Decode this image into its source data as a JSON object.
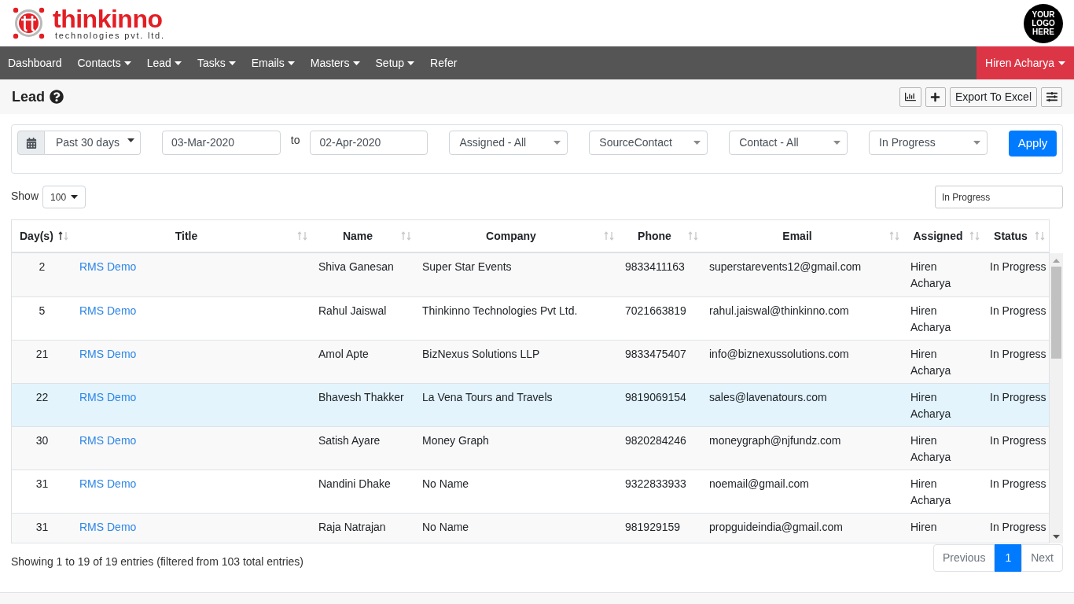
{
  "header": {
    "logo": {
      "name": "thinkinno",
      "tagline": "technologies pvt. ltd."
    },
    "client_logo": "YOUR LOGO HERE"
  },
  "nav": {
    "items": [
      {
        "label": "Dashboard",
        "dropdown": false
      },
      {
        "label": "Contacts",
        "dropdown": true
      },
      {
        "label": "Lead",
        "dropdown": true
      },
      {
        "label": "Tasks",
        "dropdown": true
      },
      {
        "label": "Emails",
        "dropdown": true
      },
      {
        "label": "Masters",
        "dropdown": true
      },
      {
        "label": "Setup",
        "dropdown": true
      },
      {
        "label": "Refer",
        "dropdown": false
      }
    ],
    "user": {
      "label": "Hiren Acharya",
      "dropdown": true
    }
  },
  "page": {
    "title": "Lead",
    "toolbar": [
      {
        "kind": "chart"
      },
      {
        "kind": "add"
      },
      {
        "kind": "text",
        "label": "Export To Excel"
      },
      {
        "kind": "sliders"
      }
    ]
  },
  "filters": {
    "range": "Past 30 days",
    "from": "03-Mar-2020",
    "to_label": "to",
    "to": "02-Apr-2020",
    "selects": [
      "Assigned - All",
      "SourceContact",
      "Contact - All",
      "In Progress"
    ],
    "apply": "Apply"
  },
  "table_controls": {
    "show_label": "Show",
    "page_length": "100",
    "search": "In Progress"
  },
  "table": {
    "columns": [
      {
        "label": "Day(s)",
        "sorted_ascending": true
      },
      {
        "label": "Title",
        "sorted_ascending": false
      },
      {
        "label": "Name",
        "sorted_ascending": false
      },
      {
        "label": "Company",
        "sorted_ascending": false
      },
      {
        "label": "Phone",
        "sorted_ascending": false
      },
      {
        "label": "Email",
        "sorted_ascending": false
      },
      {
        "label": "Assigned",
        "sorted_ascending": false
      },
      {
        "label": "Status",
        "sorted_ascending": false
      }
    ],
    "rows": [
      {
        "days": "2",
        "title": "RMS Demo",
        "name": "Shiva Ganesan",
        "company": "Super Star Events",
        "phone": "9833411163",
        "email": "superstarevents12@gmail.com",
        "assigned": "Hiren Acharya",
        "status": "In Progress",
        "selected": false
      },
      {
        "days": "5",
        "title": "RMS Demo",
        "name": "Rahul Jaiswal",
        "company": "Thinkinno Technologies Pvt Ltd.",
        "phone": "7021663819",
        "email": "rahul.jaiswal@thinkinno.com",
        "assigned": "Hiren Acharya",
        "status": "In Progress",
        "selected": false
      },
      {
        "days": "21",
        "title": "RMS Demo",
        "name": "Amol Apte",
        "company": "BizNexus Solutions LLP",
        "phone": "9833475407",
        "email": "info@biznexussolutions.com",
        "assigned": "Hiren Acharya",
        "status": "In Progress",
        "selected": false
      },
      {
        "days": "22",
        "title": "RMS Demo",
        "name": "Bhavesh Thakker",
        "company": "La Vena Tours and Travels",
        "phone": "9819069154",
        "email": "sales@lavenatours.com",
        "assigned": "Hiren Acharya",
        "status": "In Progress",
        "selected": true
      },
      {
        "days": "30",
        "title": "RMS Demo",
        "name": "Satish Ayare",
        "company": "Money Graph",
        "phone": "9820284246",
        "email": "moneygraph@njfundz.com",
        "assigned": "Hiren Acharya",
        "status": "In Progress",
        "selected": false
      },
      {
        "days": "31",
        "title": "RMS Demo",
        "name": "Nandini Dhake",
        "company": "No Name",
        "phone": "9322833933",
        "email": "noemail@gmail.com",
        "assigned": "Hiren Acharya",
        "status": "In Progress",
        "selected": false
      },
      {
        "days": "31",
        "title": "RMS Demo",
        "name": "Raja Natrajan",
        "company": "No Name",
        "phone": "981929159",
        "email": "propguideindia@gmail.com",
        "assigned": "Hiren",
        "status": "In Progress",
        "selected": false
      }
    ]
  },
  "footer": {
    "info": "Showing 1 to 19 of 19 entries (filtered from 103 total entries)",
    "pagination": [
      {
        "label": "Previous",
        "selected": false,
        "disabled": true
      },
      {
        "label": "1",
        "selected": true,
        "disabled": false
      },
      {
        "label": "Next",
        "selected": false,
        "disabled": true
      }
    ]
  }
}
